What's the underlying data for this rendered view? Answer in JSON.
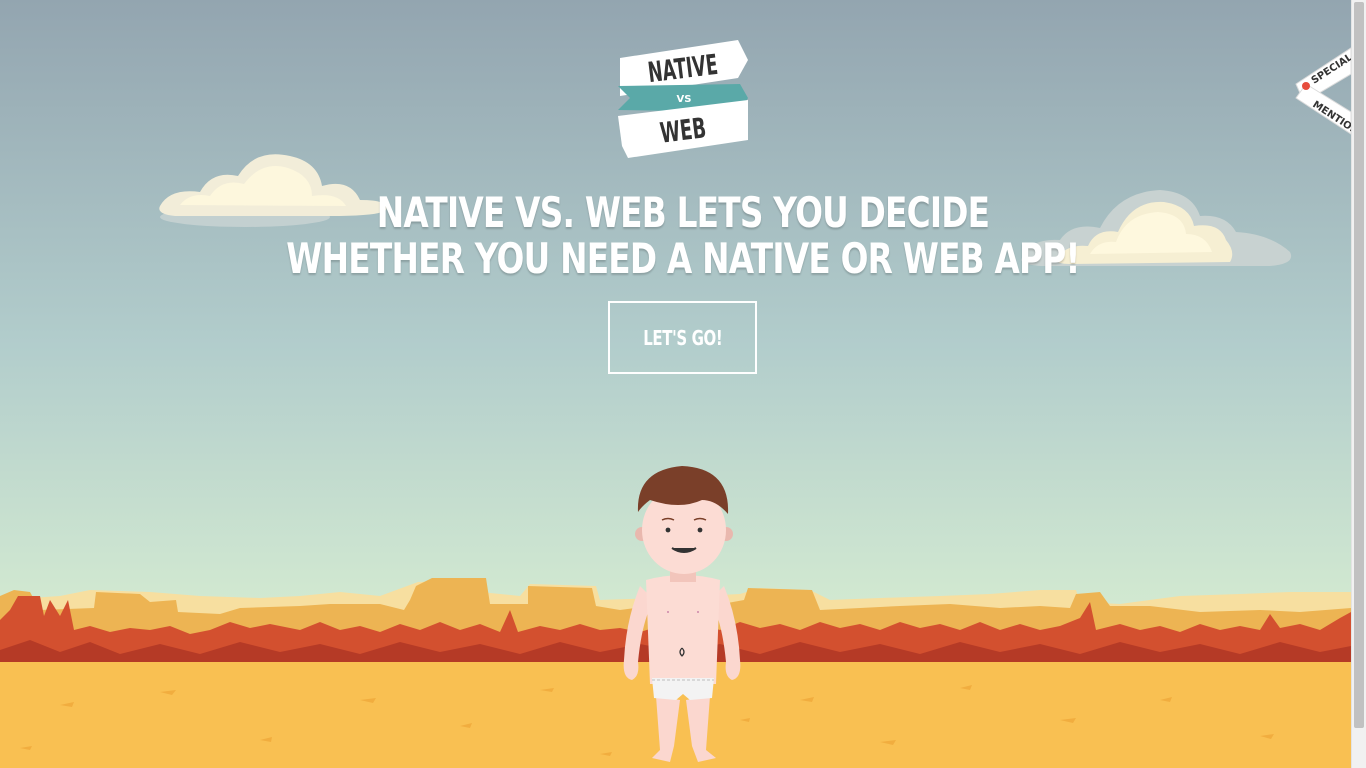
{
  "logo": {
    "top": "NATIVE",
    "middle": "VS",
    "bottom": "WEB"
  },
  "headline": {
    "line1": "NATIVE VS. WEB LETS YOU DECIDE",
    "line2": "WHETHER YOU NEED A NATIVE OR WEB APP!"
  },
  "cta": {
    "label": "LET'S GO!"
  },
  "ribbon": {
    "top": "SPECIAL",
    "bottom": "MENTION"
  },
  "colors": {
    "sky_top": "#94a6b1",
    "sky_bottom": "#c8e4d0",
    "sand": "#f9c052",
    "rock_red": "#c8442c",
    "teal": "#5aa9a8"
  }
}
